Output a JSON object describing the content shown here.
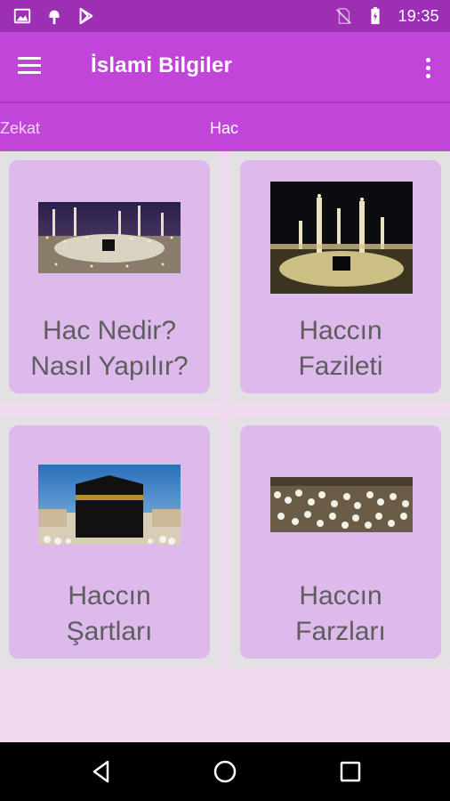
{
  "status_bar": {
    "time": "19:35",
    "icons": [
      "image-icon",
      "android-icon",
      "play-store-icon",
      "no-sim-icon",
      "battery-charging-icon"
    ]
  },
  "app_bar": {
    "title": "İslami Bilgiler",
    "menu_icon": "hamburger-menu-icon",
    "overflow_icon": "more-vertical-icon"
  },
  "tabs": [
    {
      "label": "Zekat"
    },
    {
      "label": "Hac"
    }
  ],
  "cards": [
    {
      "title_line1": "Hac Nedir?",
      "title_line2": "Nasıl Yapılır?",
      "image": "kaaba-night-panorama-photo"
    },
    {
      "title_line1": "Haccın",
      "title_line2": "Fazileti",
      "image": "masjid-al-haram-minarets-night-photo"
    },
    {
      "title_line1": "Haccın",
      "title_line2": "Şartları",
      "image": "kaaba-daylight-photo"
    },
    {
      "title_line1": "Haccın",
      "title_line2": "Farzları",
      "image": "pilgrims-crowd-photo"
    }
  ],
  "nav_bar": {
    "icons": [
      "back-icon",
      "home-icon",
      "recents-icon"
    ]
  }
}
